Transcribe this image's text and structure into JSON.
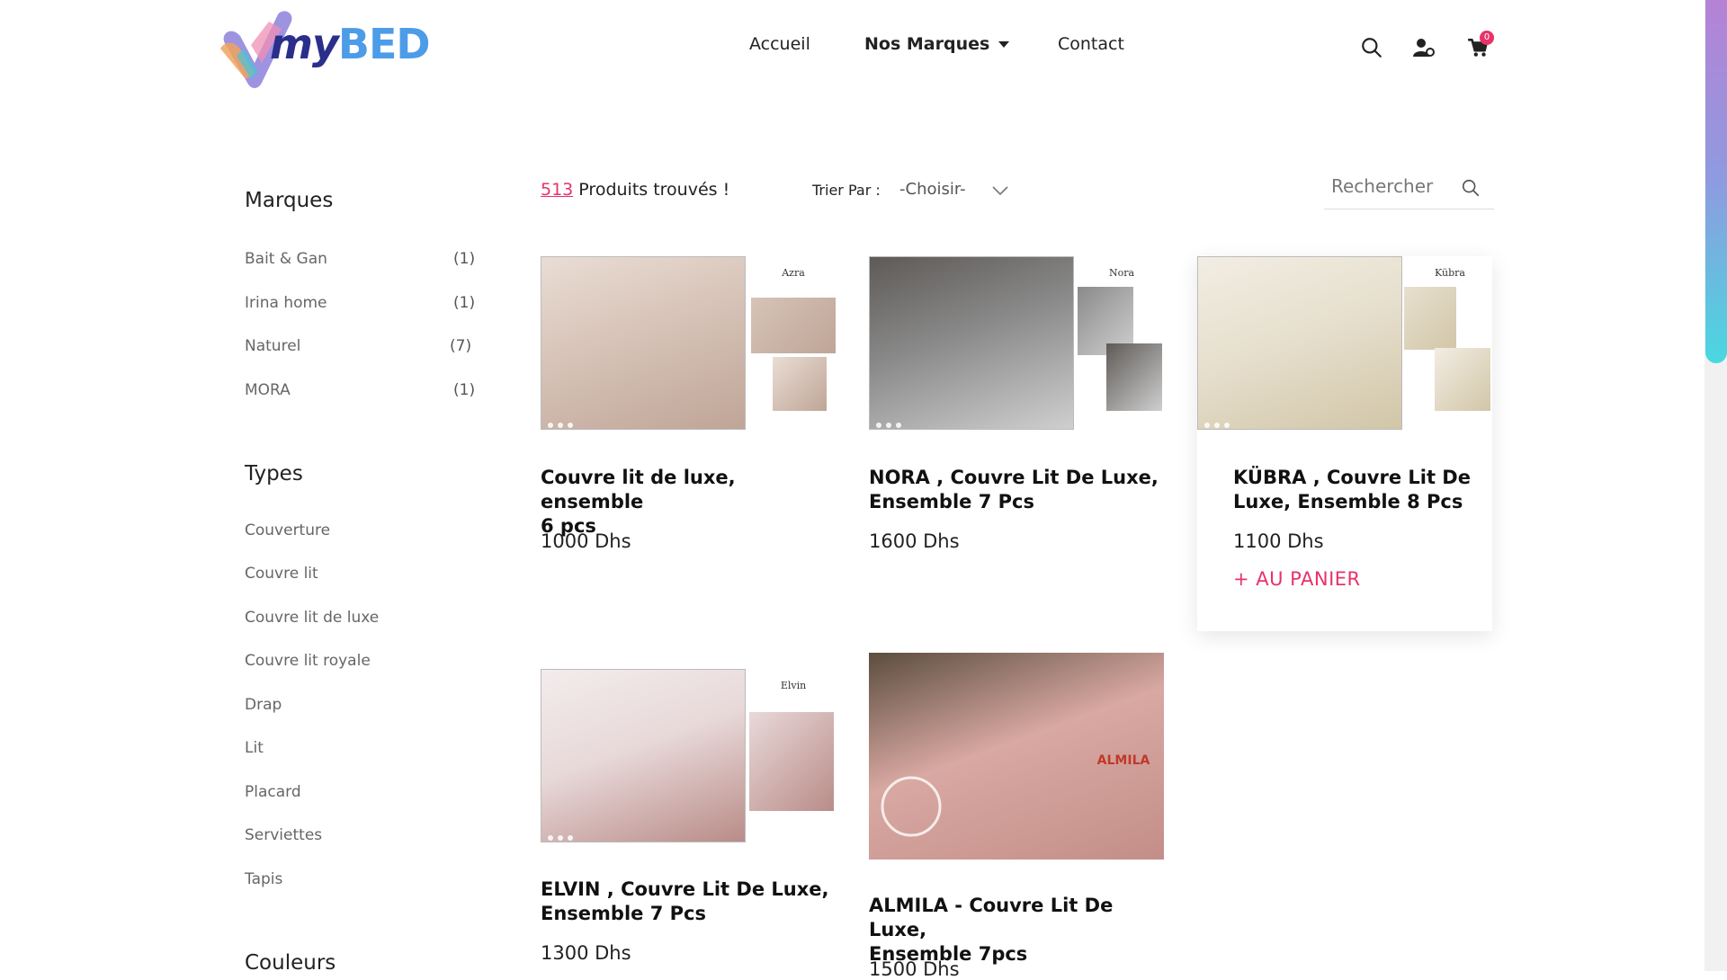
{
  "brand": {
    "logo_my": "my",
    "logo_bed": "BED"
  },
  "nav": {
    "home": "Accueil",
    "brands": "Nos Marques",
    "contact": "Contact"
  },
  "header_icons": {
    "search": "search-icon",
    "account": "user-icon",
    "cart": "cart-icon",
    "cart_count": "0"
  },
  "sidebar": {
    "brands_title": "Marques",
    "brands": [
      {
        "label": "Bait & Gan",
        "count": "(1)"
      },
      {
        "label": "Irina home",
        "count": "(1)"
      },
      {
        "label": "Naturel",
        "count": "(7)"
      },
      {
        "label": "MORA",
        "count": "(1)"
      }
    ],
    "types_title": "Types",
    "types": [
      "Couverture",
      "Couvre lit",
      "Couvre lit de luxe",
      "Couvre lit royale",
      "Drap",
      "Lit",
      "Placard",
      "Serviettes",
      "Tapis"
    ],
    "colors_title": "Couleurs"
  },
  "toolbar": {
    "found_count": "513",
    "found_label": " Produits trouvés !",
    "sort_label": "Trier Par :",
    "sort_value": "-Choisir-",
    "search_placeholder": "Rechercher"
  },
  "products": [
    {
      "title_l1": "Couvre lit de luxe, ensemble",
      "title_l2": "6 pcs",
      "price": "1000 Dhs",
      "image_label": "Azra",
      "colors": [
        "#d7c3b8",
        "#bfa597",
        "#e9ddd4"
      ]
    },
    {
      "title_l1": "NORA , Couvre Lit De Luxe,",
      "title_l2": "Ensemble 7 Pcs",
      "price": "1600 Dhs",
      "image_label": "Nora",
      "colors": [
        "#8a8a8a",
        "#cfcfcf",
        "#5e5a57"
      ]
    },
    {
      "title_l1": "KÜBRA , Couvre Lit De",
      "title_l2": "Luxe, Ensemble 8 Pcs",
      "price": "1100 Dhs",
      "add_to_cart": "+ AU PANIER",
      "image_label": "Kübra",
      "colors": [
        "#e7e0cf",
        "#d2c6a8",
        "#f2ede3"
      ]
    },
    {
      "title_l1": "ELVIN , Couvre Lit De Luxe,",
      "title_l2": "Ensemble 7 Pcs",
      "price": "1300 Dhs",
      "image_label": "Elvin",
      "colors": [
        "#e8d9d9",
        "#b98c88",
        "#f3ecec"
      ]
    },
    {
      "title_l1": "ALMILA - Couvre Lit De Luxe,",
      "title_l2": "Ensemble 7pcs",
      "price": "1500 Dhs",
      "image_label": "ALMILA",
      "colors": [
        "#d8a8a2",
        "#c48e88",
        "#5b4d3e"
      ]
    }
  ]
}
